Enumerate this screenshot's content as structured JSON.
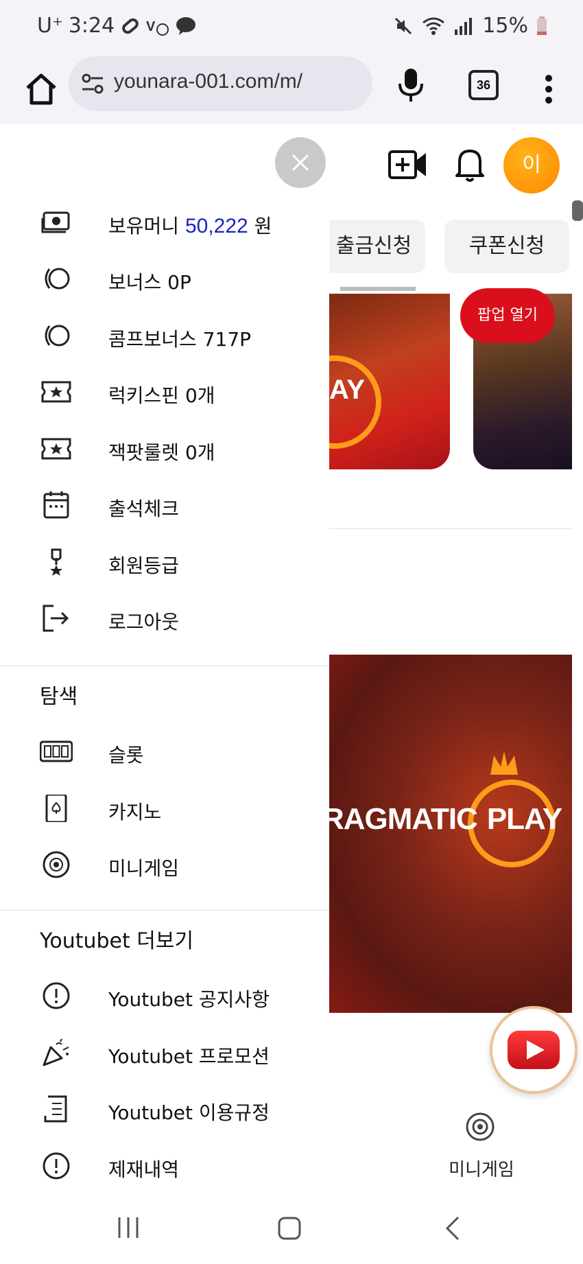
{
  "status_bar": {
    "carrier": "U⁺",
    "time": "3:24",
    "battery": "15%",
    "icons": [
      "link-icon",
      "volte-icon",
      "chat-bubble-icon",
      "mute-icon",
      "wifi-icon",
      "signal-icon",
      "battery-icon"
    ]
  },
  "browser": {
    "url": "younara-001.com/m/",
    "tab_count": "36"
  },
  "page": {
    "avatar_initial": "이",
    "withdraw_label": "출금신청",
    "coupon_label": "쿠폰신청",
    "popup_label": "팝업 열기",
    "banner1_text": "AY",
    "banner3_text": "RAGMATIC",
    "banner3_play": "PLAY",
    "bottom_minigame_label": "미니게임"
  },
  "drawer": {
    "account_items": [
      {
        "icon": "money-icon",
        "label": "보유머니 ",
        "value": "50,222",
        "suffix": " 원"
      },
      {
        "icon": "bonus-coin-icon",
        "label": "보너스 0P"
      },
      {
        "icon": "comp-bonus-icon",
        "label": "콤프보너스 717P"
      },
      {
        "icon": "ticket-star-icon",
        "label": "럭키스핀 0개"
      },
      {
        "icon": "ticket-star-icon",
        "label": "잭팟룰렛 0개"
      },
      {
        "icon": "calendar-icon",
        "label": "출석체크"
      },
      {
        "icon": "medal-icon",
        "label": "회원등급"
      },
      {
        "icon": "logout-icon",
        "label": "로그아웃"
      }
    ],
    "explore": {
      "title": "탐색",
      "items": [
        {
          "icon": "slot-machine-icon",
          "label": "슬롯"
        },
        {
          "icon": "playing-card-icon",
          "label": "카지노"
        },
        {
          "icon": "chip-icon",
          "label": "미니게임"
        }
      ]
    },
    "more": {
      "title": "Youtubet 더보기",
      "items": [
        {
          "icon": "alert-circle-icon",
          "label": "Youtubet 공지사항"
        },
        {
          "icon": "party-popper-icon",
          "label": "Youtubet 프로모션"
        },
        {
          "icon": "document-icon",
          "label": "Youtubet 이용규정"
        },
        {
          "icon": "alert-circle-icon",
          "label": "제재내역"
        }
      ]
    }
  },
  "colors": {
    "accent_money": "#1a22c8",
    "popup_red": "#d9101c",
    "avatar_orange": "#ff9a0a"
  }
}
